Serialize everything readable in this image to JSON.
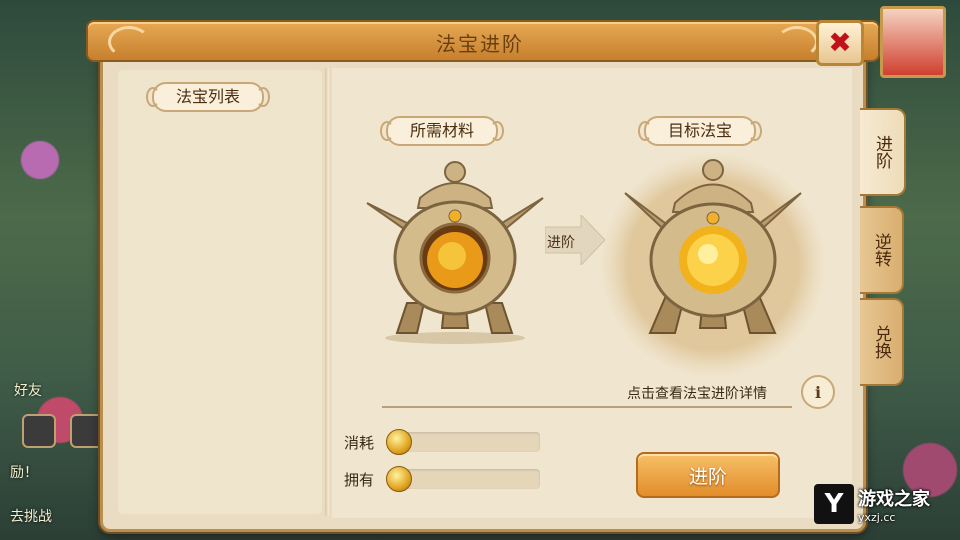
{
  "window": {
    "title": "法宝进阶"
  },
  "left_panel": {
    "title": "法宝列表"
  },
  "materials": {
    "title": "所需材料"
  },
  "target": {
    "title": "目标法宝"
  },
  "arrow": {
    "label": "进阶"
  },
  "detail": {
    "text": "点击查看法宝进阶详情",
    "info_icon": "i"
  },
  "cost": {
    "label": "消耗",
    "value": ""
  },
  "own": {
    "label": "拥有",
    "value": ""
  },
  "advance_button": {
    "label": "进阶"
  },
  "side_tabs": [
    {
      "label": "进阶",
      "active": true
    },
    {
      "label": "逆转",
      "active": false
    },
    {
      "label": "兑换",
      "active": false
    }
  ],
  "background": {
    "text_1": "好友",
    "text_2": "励！",
    "text_3": "去挑战"
  },
  "watermark": {
    "brand": "游戏之家",
    "url": "yxzj.cc",
    "mark": "Y"
  },
  "colors": {
    "accent": "#e28d2a",
    "panel": "#e9dcc2",
    "title_bar": "#d89240",
    "close": "#c0101a"
  }
}
